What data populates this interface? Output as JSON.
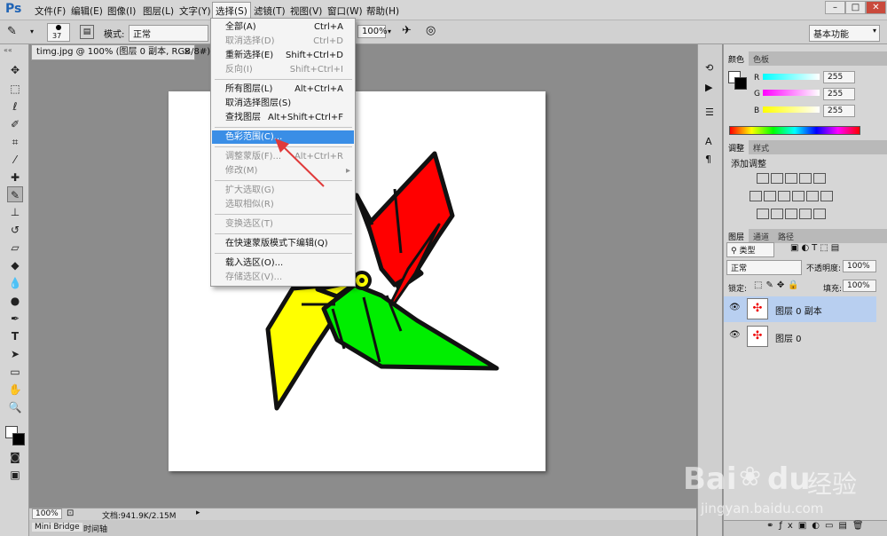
{
  "app": {
    "logo": "Ps",
    "menus": [
      "文件(F)",
      "编辑(E)",
      "图像(I)",
      "图层(L)",
      "文字(Y)",
      "选择(S)",
      "滤镜(T)",
      "视图(V)",
      "窗口(W)",
      "帮助(H)"
    ],
    "window_buttons": [
      "–",
      "□",
      "✕"
    ]
  },
  "options": {
    "brush_size": "37",
    "mode_label": "模式:",
    "mode_value": "正常",
    "flow_value": "100%",
    "workspace": "基本功能"
  },
  "document": {
    "tab_title": "timg.jpg @ 100% (图层 0 副本, RGB/8#) *",
    "tab_close": "×",
    "zoom": "100%",
    "doc_info": "文档:941.9K/2.15M"
  },
  "bottom_tabs": [
    "Mini Bridge",
    "时间轴"
  ],
  "select_menu": {
    "items": [
      {
        "label": "全部(A)",
        "shortcut": "Ctrl+A",
        "disabled": false
      },
      {
        "label": "取消选择(D)",
        "shortcut": "Ctrl+D",
        "disabled": true
      },
      {
        "label": "重新选择(E)",
        "shortcut": "Shift+Ctrl+D",
        "disabled": false
      },
      {
        "label": "反向(I)",
        "shortcut": "Shift+Ctrl+I",
        "disabled": true
      },
      {
        "label": "所有图层(L)",
        "shortcut": "Alt+Ctrl+A",
        "disabled": false
      },
      {
        "label": "取消选择图层(S)",
        "shortcut": "",
        "disabled": false
      },
      {
        "label": "查找图层",
        "shortcut": "Alt+Shift+Ctrl+F",
        "disabled": false
      },
      {
        "label": "色彩范围(C)...",
        "shortcut": "",
        "disabled": false,
        "highlighted": true
      },
      {
        "label": "调整蒙版(F)...",
        "shortcut": "Alt+Ctrl+R",
        "disabled": true
      },
      {
        "label": "修改(M)",
        "shortcut": "▸",
        "disabled": true
      },
      {
        "label": "扩大选取(G)",
        "shortcut": "",
        "disabled": true
      },
      {
        "label": "选取相似(R)",
        "shortcut": "",
        "disabled": true
      },
      {
        "label": "变换选区(T)",
        "shortcut": "",
        "disabled": true
      },
      {
        "label": "在快速蒙版模式下编辑(Q)",
        "shortcut": "",
        "disabled": false
      },
      {
        "label": "载入选区(O)...",
        "shortcut": "",
        "disabled": false
      },
      {
        "label": "存储选区(V)...",
        "shortcut": "",
        "disabled": true
      }
    ]
  },
  "color_panel": {
    "tabs": [
      "颜色",
      "色板"
    ],
    "channels": [
      {
        "name": "R",
        "value": "255"
      },
      {
        "name": "G",
        "value": "255"
      },
      {
        "name": "B",
        "value": "255"
      }
    ]
  },
  "adjust_panel": {
    "tabs": [
      "调整",
      "样式"
    ],
    "title": "添加调整"
  },
  "layers_panel": {
    "tabs": [
      "图层",
      "通道",
      "路径"
    ],
    "filter": "类型",
    "blend_mode": "正常",
    "opacity_label": "不透明度:",
    "opacity_value": "100%",
    "lock_label": "锁定:",
    "fill_label": "填充:",
    "fill_value": "100%",
    "layers": [
      {
        "name": "图层 0 副本",
        "selected": true
      },
      {
        "name": "图层 0",
        "selected": false
      }
    ]
  },
  "colors": {
    "menu_highlight": "#3a8ee6",
    "layer_selected": "#b8cff0",
    "ps_blue": "#1f63b5"
  },
  "watermark": {
    "brand": "Bai",
    "brand2": "du",
    "cn": "经验",
    "url": "jingyan.baidu.com"
  }
}
